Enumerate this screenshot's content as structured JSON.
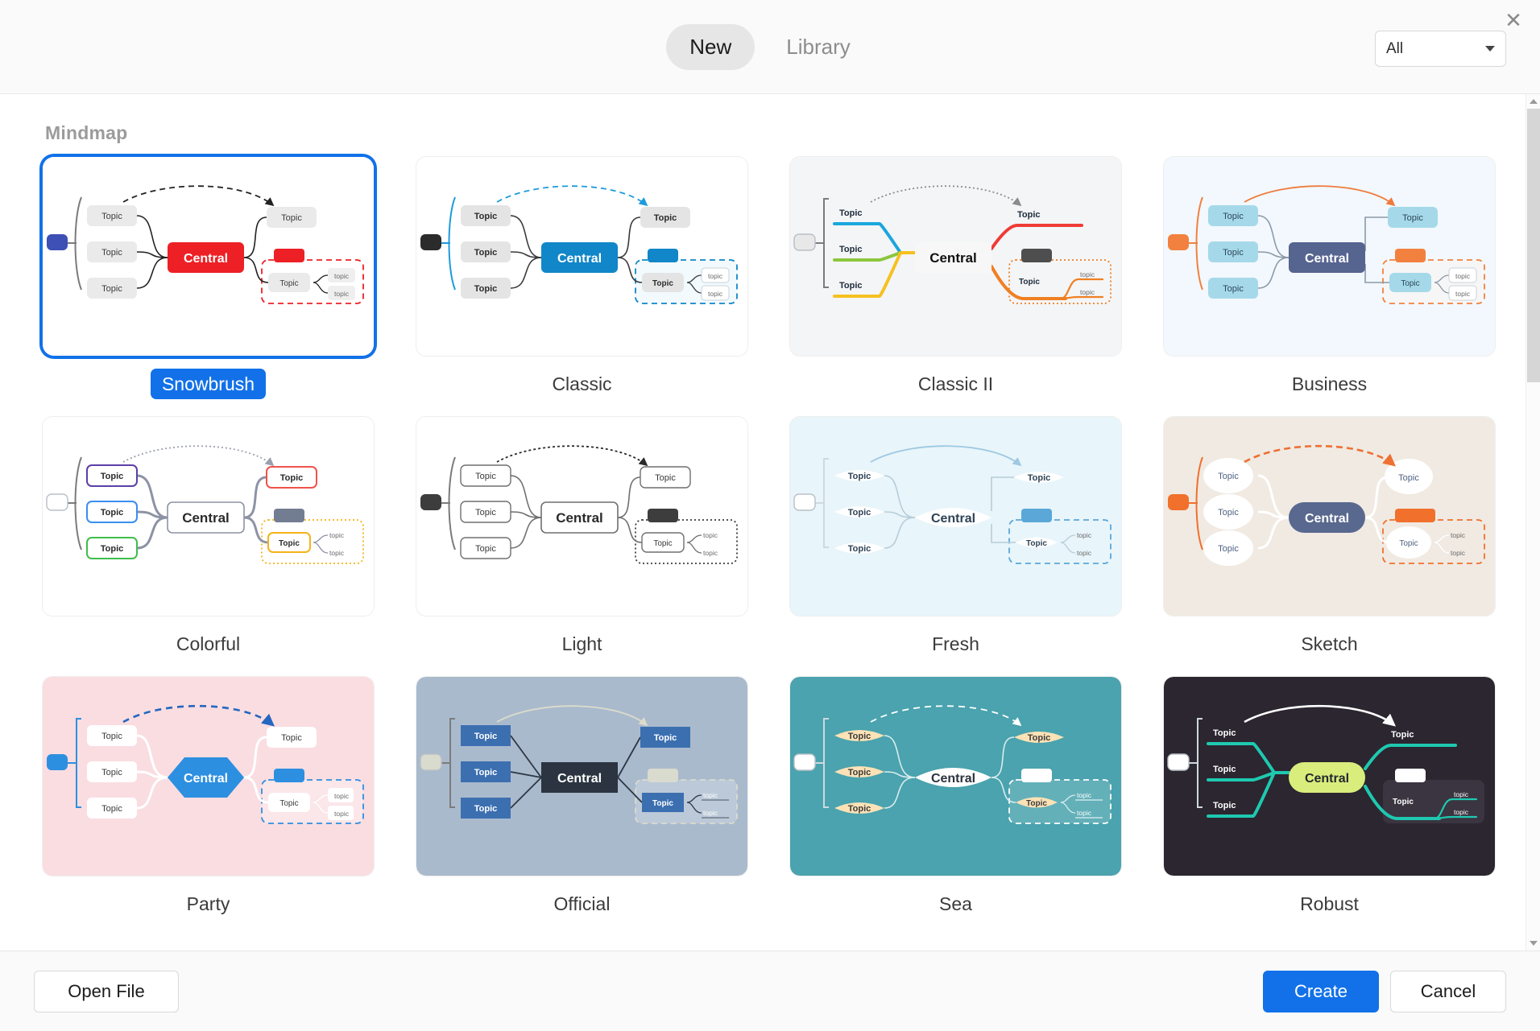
{
  "window": {
    "close_icon": "close-icon"
  },
  "header": {
    "tabs": [
      {
        "label": "New",
        "active": true
      },
      {
        "label": "Library",
        "active": false
      }
    ],
    "filter": {
      "value": "All",
      "caret_icon": "chevron-down-icon"
    }
  },
  "main": {
    "section_title": "Mindmap",
    "node_labels": {
      "central": "Central",
      "topic": "Topic",
      "subtopic": "topic"
    },
    "templates": [
      {
        "name": "Snowbrush",
        "selected": true,
        "bg": "#ffffff",
        "central_bg": "#ed2025",
        "central_fg": "#ffffff",
        "topic_bg": "#eaeaea",
        "topic_fg": "#3c3c3c",
        "line": "#222222",
        "accent": "#ed2025",
        "marker": "#3e4fb5",
        "arrow": "#222222",
        "shape": "rect"
      },
      {
        "name": "Classic",
        "selected": false,
        "bg": "#ffffff",
        "central_bg": "#1186c8",
        "central_fg": "#ffffff",
        "topic_bg": "#e4e4e4",
        "topic_fg": "#2b2b2b",
        "line": "#3a3a3a",
        "accent": "#1186c8",
        "marker": "#2b2b2b",
        "arrow": "#1e9bdc",
        "shape": "rect"
      },
      {
        "name": "Classic II",
        "selected": false,
        "bg": "#f4f5f7",
        "central_bg": "#f7f7f7",
        "central_fg": "#111111",
        "topic_bg": "transparent",
        "topic_fg": "#1d2b3a",
        "line": "#f0a020",
        "accent": "#ef8022",
        "marker": "#e8e8e8",
        "arrow": "#8b8b8b",
        "shape": "underline"
      },
      {
        "name": "Business",
        "selected": false,
        "bg": "#f2f8fd",
        "central_bg": "#566490",
        "central_fg": "#ffffff",
        "topic_bg": "#a5d9ea",
        "topic_fg": "#2c4758",
        "line": "#8c99a8",
        "accent": "#f2813f",
        "marker": "#f2813f",
        "arrow": "#ef7b3c",
        "shape": "rect"
      },
      {
        "name": "Colorful",
        "selected": false,
        "bg": "#ffffff",
        "central_bg": "#ffffff",
        "central_fg": "#2b2b2b",
        "topic_bg": "#ffffff",
        "topic_fg": "#2b2b2b",
        "line": "#8d93a4",
        "accent": "#f5b21a",
        "marker": "#ffffff",
        "arrow": "#9aa0ad",
        "shape": "outline"
      },
      {
        "name": "Light",
        "selected": false,
        "bg": "#ffffff",
        "central_bg": "#ffffff",
        "central_fg": "#2b2b2b",
        "topic_bg": "#ffffff",
        "topic_fg": "#3a3a3a",
        "line": "#6f6f6f",
        "accent": "#3d3d3d",
        "marker": "#3d3d3d",
        "arrow": "#2b2b2b",
        "shape": "outline"
      },
      {
        "name": "Fresh",
        "selected": false,
        "bg": "#e8f5fa",
        "central_bg": "#ffffff",
        "central_fg": "#2f4356",
        "topic_bg": "#ffffff",
        "topic_fg": "#2f4356",
        "line": "#b8cdd8",
        "accent": "#5aa7d8",
        "marker": "#ffffff",
        "arrow": "#9dc8e2",
        "shape": "lens"
      },
      {
        "name": "Sketch",
        "selected": false,
        "bg": "#f0eae2",
        "central_bg": "#59688f",
        "central_fg": "#ffffff",
        "topic_bg": "#ffffff",
        "topic_fg": "#4f6181",
        "line": "#ffffff",
        "accent": "#f1702c",
        "marker": "#f1702c",
        "arrow": "#ee7033",
        "shape": "circle"
      },
      {
        "name": "Party",
        "selected": false,
        "bg": "#fadde1",
        "central_bg": "#2d8fe0",
        "central_fg": "#ffffff",
        "topic_bg": "#ffffff",
        "topic_fg": "#3b3b3b",
        "line": "#ffffff",
        "accent": "#2d8fe0",
        "marker": "#2d8fe0",
        "arrow": "#2566c0",
        "shape": "hex"
      },
      {
        "name": "Official",
        "selected": false,
        "bg": "#aabacd",
        "central_bg": "#2b3440",
        "central_fg": "#ffffff",
        "topic_bg": "#3c6fb0",
        "topic_fg": "#ffffff",
        "line": "#2d3845",
        "accent": "#d9dbce",
        "marker": "#d9dbce",
        "arrow": "#dcdccb",
        "shape": "square"
      },
      {
        "name": "Sea",
        "selected": false,
        "bg": "#4aa3ae",
        "central_bg": "#ffffff",
        "central_fg": "#2b3340",
        "topic_bg": "#fce2b6",
        "topic_fg": "#3b3b3b",
        "line": "#d8ecee",
        "accent": "#ffffff",
        "marker": "#ffffff",
        "arrow": "#ffffff",
        "shape": "lens"
      },
      {
        "name": "Robust",
        "selected": false,
        "bg": "#2b2630",
        "central_bg": "#d9ed7c",
        "central_fg": "#23282f",
        "topic_bg": "transparent",
        "topic_fg": "#ffffff",
        "line": "#1ec9b0",
        "accent": "#1ec9b0",
        "marker": "#ffffff",
        "arrow": "#ffffff",
        "shape": "underline"
      }
    ]
  },
  "scrollbar": {
    "up_icon": "chevron-up-icon",
    "down_icon": "chevron-down-icon"
  },
  "footer": {
    "open_file": "Open File",
    "create": "Create",
    "cancel": "Cancel"
  }
}
